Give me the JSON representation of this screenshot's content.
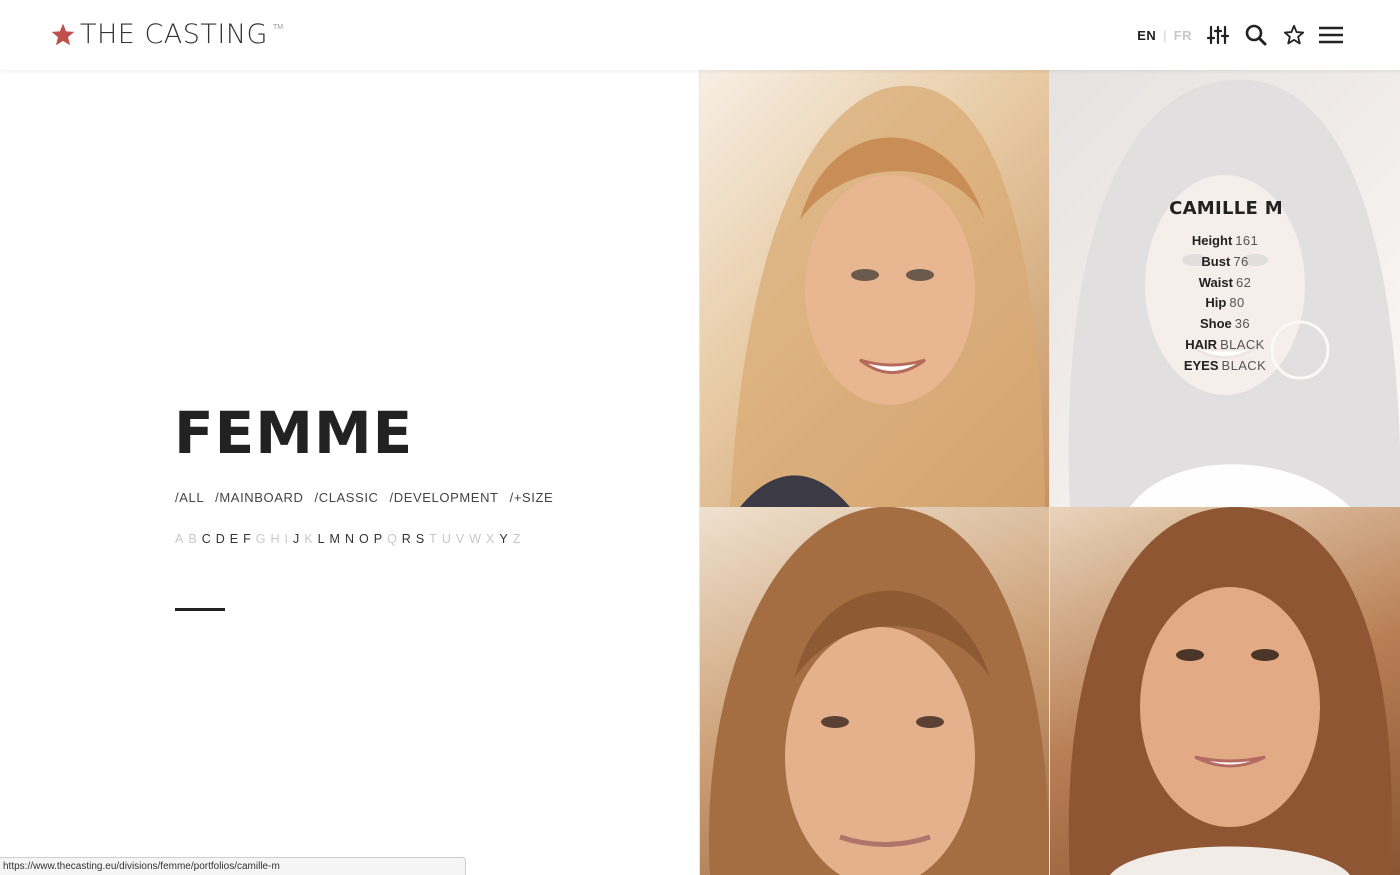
{
  "brand": {
    "name": "THE CASTING",
    "tm": "TM",
    "star_color": "#c0504d"
  },
  "header": {
    "lang_en": "EN",
    "lang_fr": "FR",
    "lang_separator": "|",
    "icons": [
      "sliders-icon",
      "search-icon",
      "star-icon",
      "menu-icon"
    ]
  },
  "section": {
    "title": "FEMME",
    "filters": [
      "/ALL",
      "/MAINBOARD",
      "/CLASSIC",
      "/DEVELOPMENT",
      "/+SIZE"
    ],
    "alphabet": [
      {
        "letter": "A",
        "active": false
      },
      {
        "letter": "B",
        "active": false
      },
      {
        "letter": "C",
        "active": true
      },
      {
        "letter": "D",
        "active": true
      },
      {
        "letter": "E",
        "active": true
      },
      {
        "letter": "F",
        "active": true
      },
      {
        "letter": "G",
        "active": false
      },
      {
        "letter": "H",
        "active": false
      },
      {
        "letter": "I",
        "active": false
      },
      {
        "letter": "J",
        "active": true
      },
      {
        "letter": "K",
        "active": false
      },
      {
        "letter": "L",
        "active": true
      },
      {
        "letter": "M",
        "active": true
      },
      {
        "letter": "N",
        "active": true
      },
      {
        "letter": "O",
        "active": true
      },
      {
        "letter": "P",
        "active": true
      },
      {
        "letter": "Q",
        "active": false
      },
      {
        "letter": "R",
        "active": true
      },
      {
        "letter": "S",
        "active": true
      },
      {
        "letter": "T",
        "active": false
      },
      {
        "letter": "U",
        "active": false
      },
      {
        "letter": "V",
        "active": false
      },
      {
        "letter": "W",
        "active": false
      },
      {
        "letter": "X",
        "active": false
      },
      {
        "letter": "Y",
        "active": true
      },
      {
        "letter": "Z",
        "active": false
      }
    ]
  },
  "hover_card": {
    "name": "CAMILLE M",
    "stats": [
      {
        "label": "Height",
        "value": "161"
      },
      {
        "label": "Bust",
        "value": "76"
      },
      {
        "label": "Waist",
        "value": "62"
      },
      {
        "label": "Hip",
        "value": "80"
      },
      {
        "label": "Shoe",
        "value": "36"
      },
      {
        "label": "HAIR",
        "value": "BLACK"
      },
      {
        "label": "EYES",
        "value": "BLACK"
      }
    ]
  },
  "status_url": "https://www.thecasting.eu/divisions/femme/portfolios/camille-m"
}
